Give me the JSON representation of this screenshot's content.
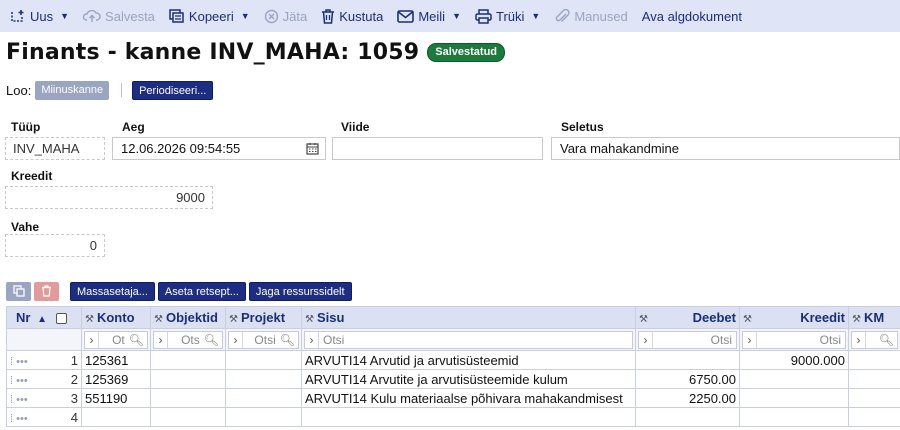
{
  "toolbar": {
    "new_label": "Uus",
    "save_label": "Salvesta",
    "copy_label": "Kopeeri",
    "cancel_label": "Jäta",
    "delete_label": "Kustuta",
    "mail_label": "Meili",
    "print_label": "Trüki",
    "attachments_label": "Manused",
    "open_source_label": "Ava algdokument"
  },
  "header": {
    "title": "Finants - kanne INV_MAHA: 1059",
    "status": "Salvestatud"
  },
  "create": {
    "label": "Loo:",
    "minus_entry": "Miinuskanne",
    "periodize": "Periodiseeri..."
  },
  "fields": {
    "type_label": "Tüüp",
    "type_value": "INV_MAHA",
    "time_label": "Aeg",
    "time_value": "12.06.2026 09:54:55",
    "ref_label": "Viide",
    "ref_value": "",
    "expl_label": "Seletus",
    "expl_value": "Vara mahakandmine",
    "credit_label": "Kreedit",
    "credit_value": "9000",
    "diff_label": "Vahe",
    "diff_value": "0"
  },
  "grid_tools": {
    "mass_set": "Massasetaja...",
    "recipe": "Aseta retsept...",
    "split": "Jaga ressurssidelt"
  },
  "table": {
    "headers": {
      "nr": "Nr",
      "konto": "Konto",
      "objekt": "Objektid",
      "projekt": "Projekt",
      "sisu": "Sisu",
      "deebet": "Deebet",
      "kreedit": "Kreedit",
      "km": "KM"
    },
    "filter_placeholders": {
      "konto": "Ot",
      "objekt": "Ots",
      "projekt": "Otsi",
      "sisu": "Otsi",
      "deebet": "Otsi",
      "kreedit": "Otsi"
    },
    "rows": [
      {
        "nr": "1",
        "konto": "125361",
        "sisu": "ARVUTI14 Arvutid ja arvutisüsteemid",
        "deebet": "",
        "kreedit": "9000.000"
      },
      {
        "nr": "2",
        "konto": "125369",
        "sisu": "ARVUTI14 Arvutite ja arvutisüsteemide kulum",
        "deebet": "6750.00",
        "kreedit": ""
      },
      {
        "nr": "3",
        "konto": "551190",
        "sisu": "ARVUTI14 Kulu materiaalse põhivara mahakandmisest",
        "deebet": "2250.00",
        "kreedit": ""
      },
      {
        "nr": "4",
        "konto": "",
        "sisu": "",
        "deebet": "",
        "kreedit": ""
      }
    ]
  }
}
